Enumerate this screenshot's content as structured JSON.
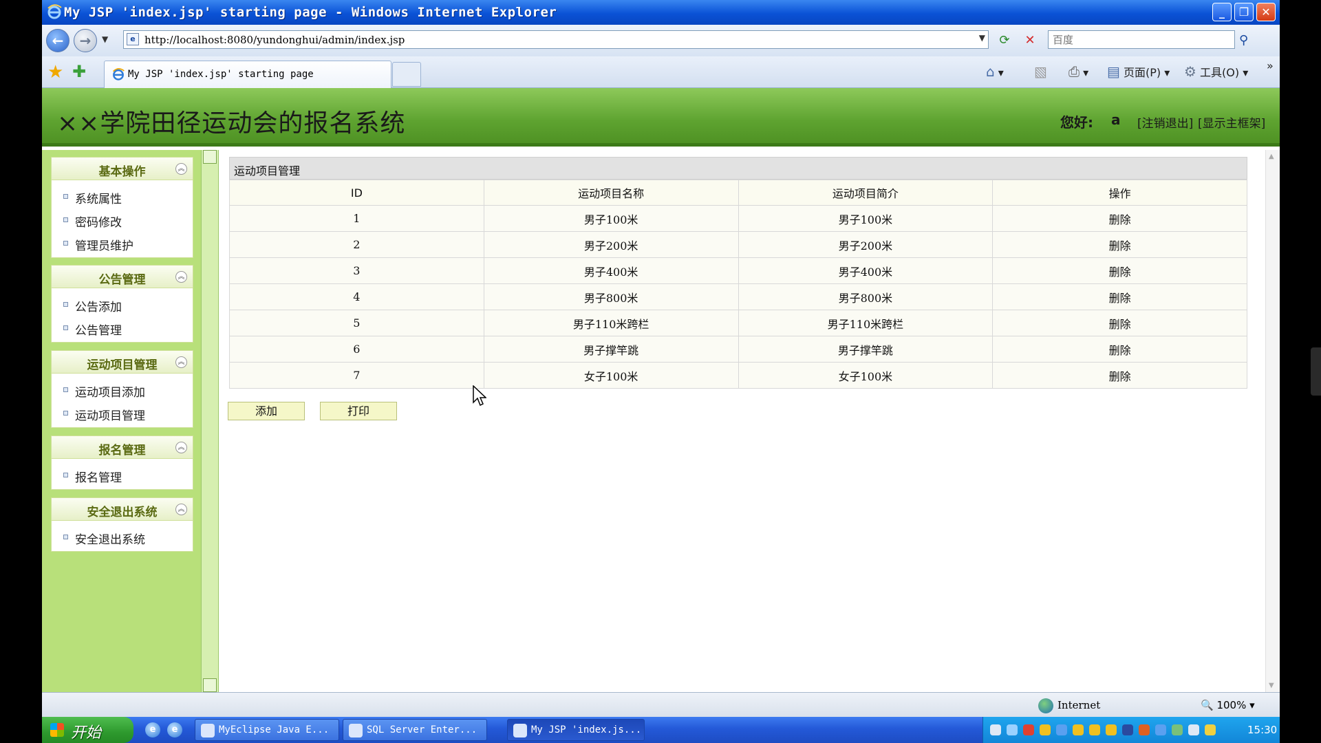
{
  "window": {
    "title": "My JSP 'index.jsp' starting page - Windows Internet Explorer",
    "minimize": "_",
    "maximize": "❐",
    "close": "✕"
  },
  "address_bar": {
    "url": "http://localhost:8080/yundonghui/admin/index.jsp",
    "search_placeholder": "百度"
  },
  "tab": {
    "title": "My JSP 'index.jsp' starting page"
  },
  "commands": {
    "page": "页面(P)",
    "tools": "工具(O)"
  },
  "header": {
    "site_title": "××学院田径运动会的报名系统",
    "greeting": "您好:",
    "username": "a",
    "logout": "[注销退出]",
    "show_frame": "[显示主框架]"
  },
  "sidebar": {
    "groups": [
      {
        "title": "基本操作",
        "items": [
          "系统属性",
          "密码修改",
          "管理员维护"
        ]
      },
      {
        "title": "公告管理",
        "items": [
          "公告添加",
          "公告管理"
        ]
      },
      {
        "title": "运动项目管理",
        "items": [
          "运动项目添加",
          "运动项目管理"
        ]
      },
      {
        "title": "报名管理",
        "items": [
          "报名管理"
        ]
      },
      {
        "title": "安全退出系统",
        "items": [
          "安全退出系统"
        ]
      }
    ]
  },
  "main": {
    "panel_title": "运动项目管理",
    "columns": [
      "ID",
      "运动项目名称",
      "运动项目简介",
      "操作"
    ],
    "rows": [
      [
        "1",
        "男子100米",
        "男子100米",
        "删除"
      ],
      [
        "2",
        "男子200米",
        "男子200米",
        "删除"
      ],
      [
        "3",
        "男子400米",
        "男子400米",
        "删除"
      ],
      [
        "4",
        "男子800米",
        "男子800米",
        "删除"
      ],
      [
        "5",
        "男子110米跨栏",
        "男子110米跨栏",
        "删除"
      ],
      [
        "6",
        "男子撑竿跳",
        "男子撑竿跳",
        "删除"
      ],
      [
        "7",
        "女子100米",
        "女子100米",
        "删除"
      ]
    ],
    "add_button": "添加",
    "print_button": "打印"
  },
  "statusbar": {
    "zone": "Internet",
    "zoom": "100%"
  },
  "taskbar": {
    "start": "开始",
    "tasks": [
      "MyEclipse Java E...",
      "SQL Server Enter...",
      "My JSP 'index.js..."
    ],
    "clock": "15:30"
  },
  "colors": {
    "header_green": "#5ea330",
    "sidebar_green": "#b8e07a",
    "xp_blue": "#0a52d6"
  }
}
